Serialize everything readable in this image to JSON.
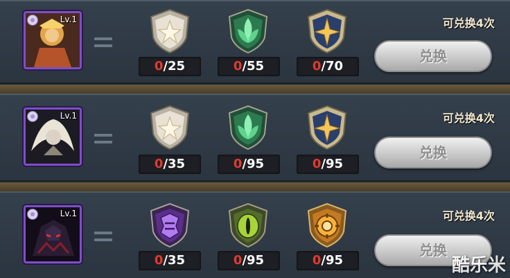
{
  "rows": [
    {
      "level": "Lv.1",
      "hero": "monkey-king",
      "limit": "可兑换4次",
      "button": "兑换",
      "costs": [
        {
          "icon": "silver-star-badge-icon",
          "have": "0",
          "need": "/25"
        },
        {
          "icon": "green-leaf-badge-icon",
          "have": "0",
          "need": "/55"
        },
        {
          "icon": "gold-star-badge-icon",
          "have": "0",
          "need": "/70"
        }
      ]
    },
    {
      "level": "Lv.1",
      "hero": "white-hair-warrior",
      "limit": "可兑换4次",
      "button": "兑换",
      "costs": [
        {
          "icon": "silver-star-badge-icon",
          "have": "0",
          "need": "/35"
        },
        {
          "icon": "green-leaf-badge-icon",
          "have": "0",
          "need": "/95"
        },
        {
          "icon": "gold-star-badge-icon",
          "have": "0",
          "need": "/95"
        }
      ]
    },
    {
      "level": "Lv.1",
      "hero": "dark-knight",
      "limit": "可兑换4次",
      "button": "兑换",
      "costs": [
        {
          "icon": "purple-crest-badge-icon",
          "have": "0",
          "need": "/35"
        },
        {
          "icon": "green-eye-badge-icon",
          "have": "0",
          "need": "/95"
        },
        {
          "icon": "orange-gear-badge-icon",
          "have": "0",
          "need": "/95"
        }
      ]
    }
  ],
  "watermark": "酷乐米",
  "colors": {
    "panel": "#2f3a45",
    "frame": "#7d4fc9",
    "count_have": "#e23a2e",
    "count_need": "#ffffff"
  }
}
